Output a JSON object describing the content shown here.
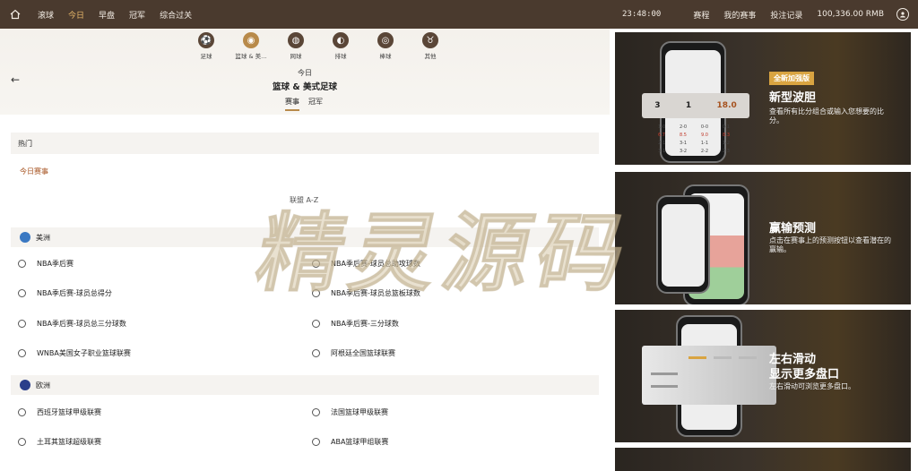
{
  "topbar": {
    "nav": [
      "滚球",
      "今日",
      "早盘",
      "冠军",
      "综合过关"
    ],
    "active_nav": "今日",
    "clock": "23:48:00",
    "links": [
      "赛程",
      "我的赛事",
      "投注记录"
    ],
    "balance": "100,336.00 RMB"
  },
  "sports": [
    {
      "label": "足球",
      "icon": "soccer-icon",
      "glyph": "⚽"
    },
    {
      "label": "篮球 & 美…",
      "icon": "basketball-icon",
      "glyph": "◉"
    },
    {
      "label": "网球",
      "icon": "tennis-icon",
      "glyph": "◍"
    },
    {
      "label": "排球",
      "icon": "volleyball-icon",
      "glyph": "◐"
    },
    {
      "label": "棒球",
      "icon": "baseball-icon",
      "glyph": "◎"
    },
    {
      "label": "其他",
      "icon": "other-sports-icon",
      "glyph": "♉"
    }
  ],
  "header": {
    "day": "今日",
    "title": "篮球 & 美式足球",
    "tabs": [
      "赛事",
      "冠军"
    ]
  },
  "content": {
    "hot": "热门",
    "today_matches": "今日赛事",
    "az": "联盟 A-Z",
    "regions": [
      {
        "name": "美洲",
        "leagues": [
          "NBA季后赛",
          "NBA季后赛-球员总助攻球数",
          "NBA季后赛-球员总得分",
          "NBA季后赛-球员总篮板球数",
          "NBA季后赛-球员总三分球数",
          "NBA季后赛-三分球数",
          "WNBA美国女子职业篮球联赛",
          "阿根廷全国篮球联赛"
        ]
      },
      {
        "name": "欧洲",
        "leagues": [
          "西班牙篮球甲级联赛",
          "法国篮球甲级联赛",
          "土耳其篮球超级联赛",
          "ABA篮球甲组联赛"
        ]
      }
    ]
  },
  "promos": [
    {
      "badge": "全新加强版",
      "title": "新型波胆",
      "desc": "查看所有比分组合或输入您想要的比分。",
      "score": [
        "3",
        "1",
        "18.0"
      ]
    },
    {
      "title": "赢输预测",
      "desc": "点击在赛事上的预测按钮以查看潜在的赢输。"
    },
    {
      "title1": "左右滑动",
      "title2": "显示更多盘口",
      "desc": "左右滑动可浏览更多盘口。"
    }
  ],
  "watermark": "精灵源码",
  "colors": {
    "topbar": "#4a3a2e",
    "accent": "#b88a4a",
    "link": "#a6521f"
  }
}
